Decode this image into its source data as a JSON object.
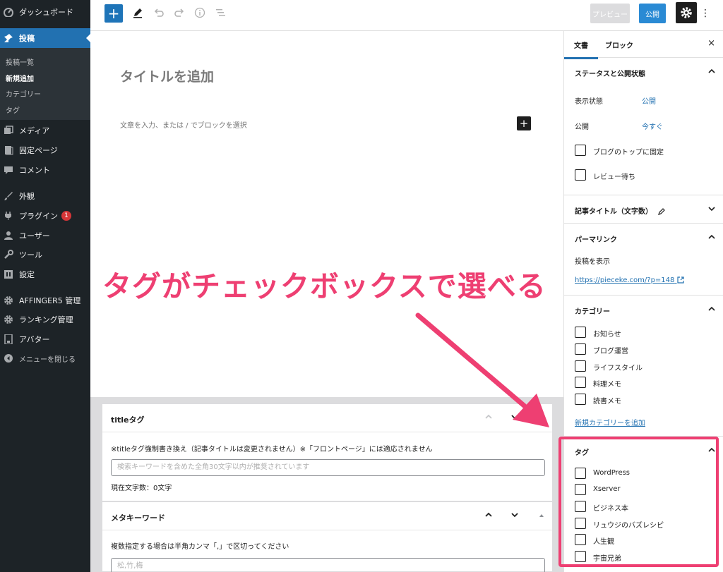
{
  "admin_menu": {
    "dashboard": "ダッシュボード",
    "posts": "投稿",
    "posts_sub": [
      "投稿一覧",
      "新規追加",
      "カテゴリー",
      "タグ"
    ],
    "media": "メディア",
    "pages": "固定ページ",
    "comments": "コメント",
    "appearance": "外観",
    "plugins": "プラグイン",
    "plugins_badge": "1",
    "users": "ユーザー",
    "tools": "ツール",
    "settings": "設定",
    "affinger": "AFFINGER5 管理",
    "ranking": "ランキング管理",
    "avatar": "アバター",
    "collapse": "メニューを閉じる"
  },
  "toolbar": {
    "add_label": "+",
    "preview_label": "プレビュー",
    "publish_label": "公開",
    "more_label": "⋮"
  },
  "editor": {
    "title_placeholder": "タイトルを追加",
    "block_hint": "文章を入力、または / でブロックを選択",
    "inline_add": "+"
  },
  "metaboxes": {
    "title_tag": {
      "title": "titleタグ",
      "desc": "※titleタグ強制書き換え（記事タイトルは変更されません）※「フロントページ」には適応されません",
      "placeholder": "検索キーワードを含めた全角30文字以内が推奨されています",
      "count": "現在文字数：0文字"
    },
    "meta_keyword": {
      "title": "メタキーワード",
      "desc": "複数指定する場合は半角カンマ「,」で区切ってください",
      "placeholder": "松,竹,梅"
    }
  },
  "sidebar": {
    "tab_document": "文書",
    "tab_block": "ブロック",
    "close": "×",
    "status_panel": {
      "title": "ステータスと公開状態",
      "visibility_label": "表示状態",
      "visibility_value": "公開",
      "publish_label": "公開",
      "publish_value": "今すぐ",
      "sticky_label": "ブログのトップに固定",
      "pending_label": "レビュー待ち"
    },
    "char_count_panel": {
      "title": "記事タイトル（文字数）"
    },
    "permalink_panel": {
      "title": "パーマリンク",
      "view_label": "投稿を表示",
      "url": "https://pieceke.com/?p=148"
    },
    "category_panel": {
      "title": "カテゴリー",
      "items": [
        "お知らせ",
        "ブログ運営",
        "ライフスタイル",
        "料理メモ",
        "読書メモ"
      ],
      "add_link": "新規カテゴリーを追加"
    },
    "tag_panel": {
      "title": "タグ",
      "items": [
        "WordPress",
        "Xserver",
        "ビジネス本",
        "リュウジのバズレシピ",
        "人生観",
        "宇宙兄弟"
      ]
    }
  },
  "annotation": {
    "text": "タグがチェックボックスで選べる",
    "color": "#ee3f72"
  }
}
